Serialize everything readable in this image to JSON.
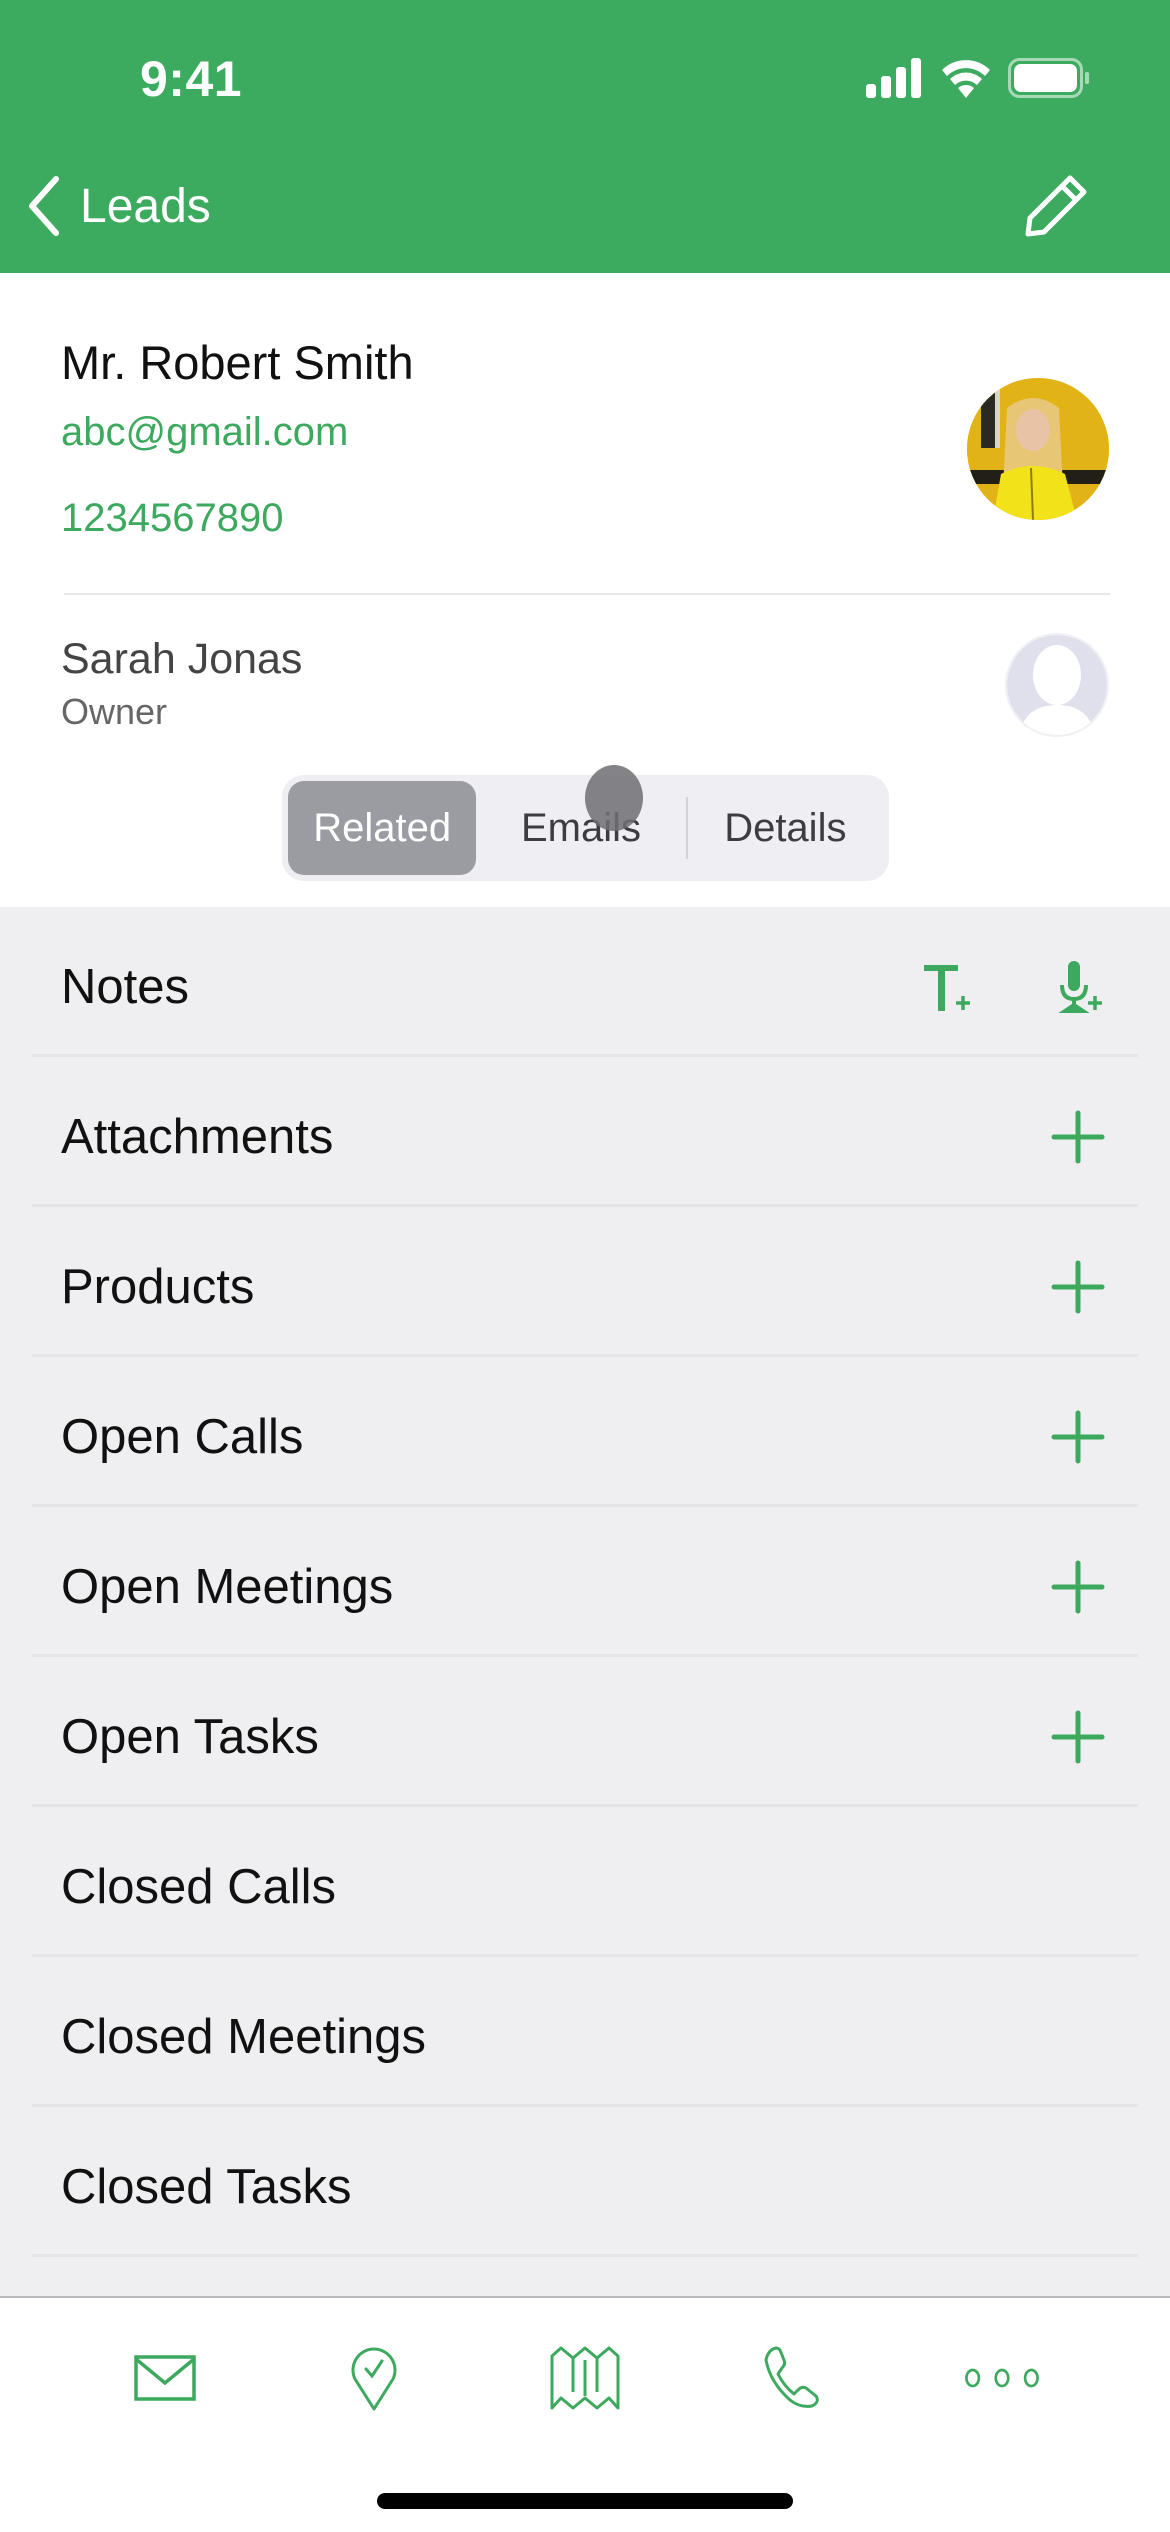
{
  "status_bar": {
    "time": "9:41",
    "icons": [
      "cellular-signal-icon",
      "wifi-icon",
      "battery-icon"
    ]
  },
  "nav": {
    "back_label": "Leads",
    "back_icon": "chevron-left-icon",
    "edit_icon": "pencil-icon"
  },
  "contact": {
    "name": "Mr. Robert Smith",
    "email": "abc@gmail.com",
    "phone": "1234567890",
    "avatar": "contact-photo"
  },
  "owner": {
    "name": "Sarah Jonas",
    "label": "Owner",
    "avatar": "placeholder-person-icon"
  },
  "segmented": {
    "options": [
      "Related",
      "Emails",
      "Details"
    ],
    "selected": "Related"
  },
  "related": {
    "rows": [
      {
        "label": "Notes",
        "actions": [
          "add-text-note-icon",
          "add-voice-note-icon"
        ]
      },
      {
        "label": "Attachments",
        "actions": [
          "plus-icon"
        ]
      },
      {
        "label": "Products",
        "actions": [
          "plus-icon"
        ]
      },
      {
        "label": "Open Calls",
        "actions": [
          "plus-icon"
        ]
      },
      {
        "label": "Open Meetings",
        "actions": [
          "plus-icon"
        ]
      },
      {
        "label": "Open Tasks",
        "actions": [
          "plus-icon"
        ]
      },
      {
        "label": "Closed Calls",
        "actions": []
      },
      {
        "label": "Closed Meetings",
        "actions": []
      },
      {
        "label": "Closed Tasks",
        "actions": []
      }
    ]
  },
  "tabbar": {
    "items": [
      "mail-icon",
      "location-check-icon",
      "map-icon",
      "phone-icon",
      "more-icon"
    ]
  },
  "colors": {
    "brand_green": "#3dab5f",
    "accent_text_green": "#3ca95e",
    "list_background": "#efeef1",
    "segment_selected": "#9a9ca2"
  }
}
